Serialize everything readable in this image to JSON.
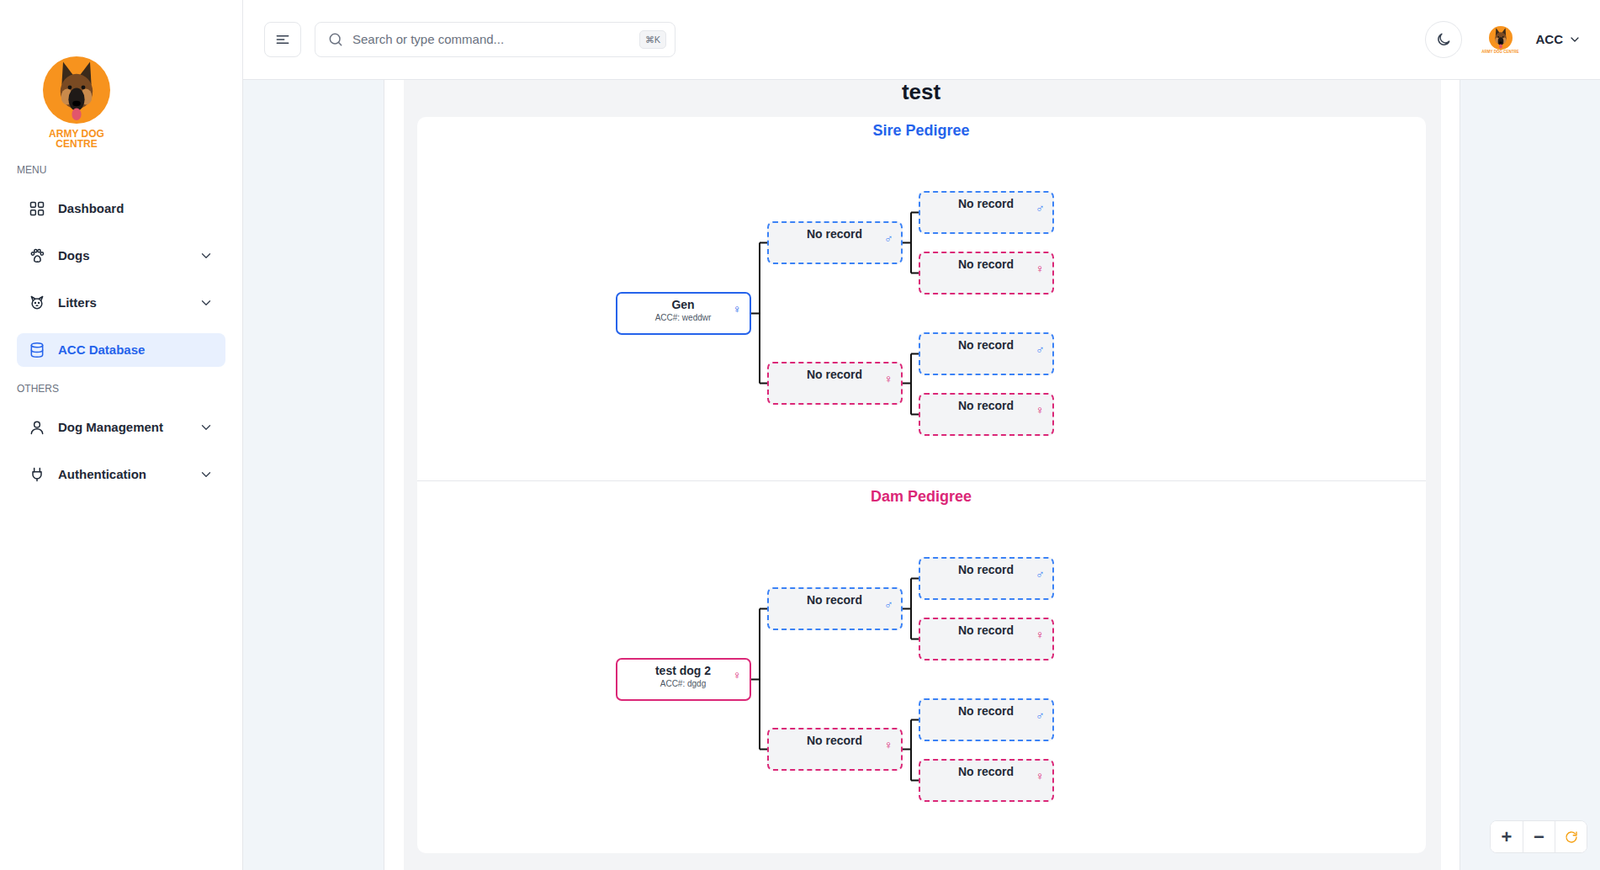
{
  "sidebar": {
    "logo": {
      "lines": [
        "ARMY DOG",
        "CENTRE"
      ]
    },
    "sections": [
      {
        "heading": "MENU",
        "items": [
          {
            "label": "Dashboard",
            "kind": "link",
            "selected": false
          },
          {
            "label": "Dogs",
            "kind": "dropdown",
            "selected": false,
            "expanded": false
          },
          {
            "label": "Litters",
            "kind": "dropdown",
            "selected": false,
            "expanded": false
          },
          {
            "label": "ACC Database",
            "kind": "link",
            "selected": true
          }
        ]
      },
      {
        "heading": "OTHERS",
        "items": [
          {
            "label": "Dog Management",
            "kind": "dropdown",
            "selected": false,
            "expanded": false
          },
          {
            "label": "Authentication",
            "kind": "dropdown",
            "selected": false,
            "expanded": false
          }
        ]
      }
    ]
  },
  "header": {
    "search": {
      "placeholder": "Search or type command...",
      "shortcut": "⌘K"
    },
    "user": {
      "name": "ACC",
      "avatar_text": "ARMY DOG CENTRE"
    }
  },
  "page": {
    "title": "test"
  },
  "pedigrees": [
    {
      "title": "Sire Pedigree",
      "color": "#2563eb",
      "nodes": [
        {
          "label": "Gen",
          "acc": "ACC#: weddwr",
          "symbol": "♀",
          "color": "#2563eb",
          "kind": "record"
        },
        {
          "label": "No record",
          "symbol": "♂",
          "color": "#3b82f6",
          "kind": "empty"
        },
        {
          "label": "No record",
          "symbol": "♀",
          "color": "#db2777",
          "kind": "empty"
        },
        {
          "label": "No record",
          "symbol": "♂",
          "color": "#3b82f6",
          "kind": "empty"
        },
        {
          "label": "No record",
          "symbol": "♀",
          "color": "#db2777",
          "kind": "empty"
        },
        {
          "label": "No record",
          "symbol": "♂",
          "color": "#3b82f6",
          "kind": "empty"
        },
        {
          "label": "No record",
          "symbol": "♀",
          "color": "#db2777",
          "kind": "empty"
        }
      ]
    },
    {
      "title": "Dam Pedigree",
      "color": "#db2777",
      "nodes": [
        {
          "label": "test dog 2",
          "acc": "ACC#: dgdg",
          "symbol": "♀",
          "color": "#db2777",
          "kind": "record"
        },
        {
          "label": "No record",
          "symbol": "♂",
          "color": "#3b82f6",
          "kind": "empty"
        },
        {
          "label": "No record",
          "symbol": "♀",
          "color": "#db2777",
          "kind": "empty"
        },
        {
          "label": "No record",
          "symbol": "♂",
          "color": "#3b82f6",
          "kind": "empty"
        },
        {
          "label": "No record",
          "symbol": "♀",
          "color": "#db2777",
          "kind": "empty"
        },
        {
          "label": "No record",
          "symbol": "♂",
          "color": "#3b82f6",
          "kind": "empty"
        },
        {
          "label": "No record",
          "symbol": "♀",
          "color": "#db2777",
          "kind": "empty"
        }
      ]
    }
  ],
  "zoom": {
    "buttons": [
      "+",
      "−"
    ]
  }
}
